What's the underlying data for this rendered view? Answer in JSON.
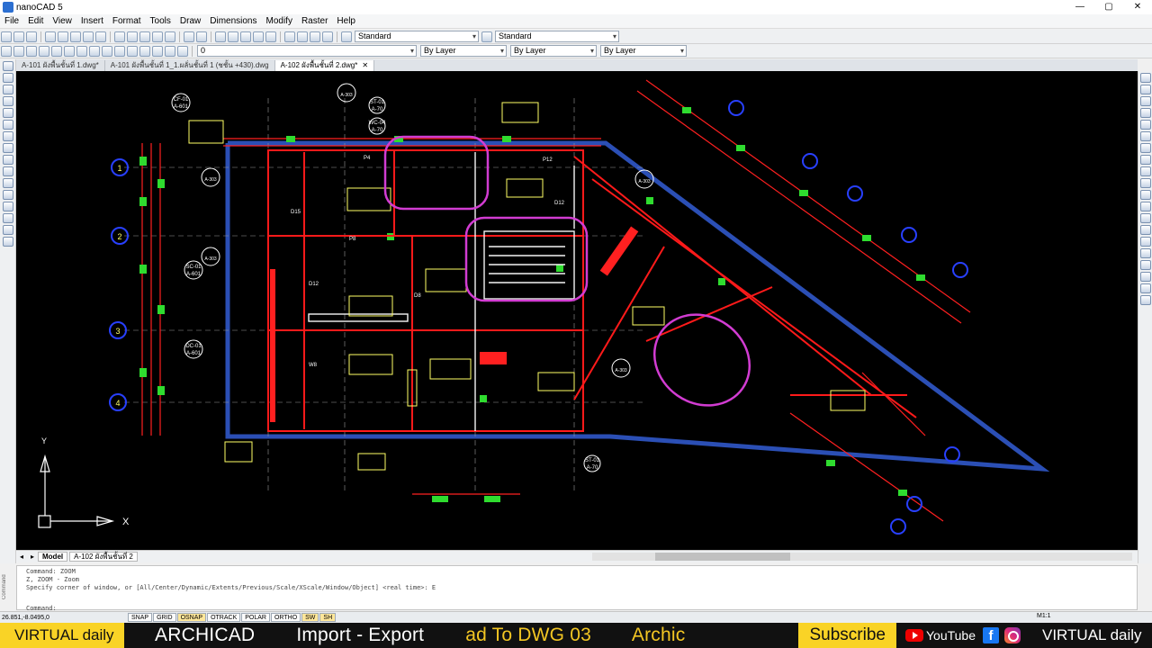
{
  "window": {
    "title": "nanoCAD 5",
    "controls": [
      "—",
      "▢",
      "✕"
    ]
  },
  "menu": [
    "File",
    "Edit",
    "View",
    "Insert",
    "Format",
    "Tools",
    "Draw",
    "Dimensions",
    "Modify",
    "Raster",
    "Help"
  ],
  "toolbar": {
    "text_style": "Standard",
    "dim_style": "Standard",
    "layer": "0",
    "color": "By Layer",
    "linetype": "By Layer",
    "lineweight": "By Layer"
  },
  "tabs": [
    {
      "label": "A-101 ผังพื้นชั้นที่ 1.dwg*",
      "active": false
    },
    {
      "label": "A-101 ผังพื้นชั้นที่ 1_1.ผลั่นชั้นที่ 1 (ชชั้น +430).dwg",
      "active": false
    },
    {
      "label": "A-102 ผังพื้นชั้นที่ 2.dwg*",
      "active": true
    }
  ],
  "drawing": {
    "grid_bubbles": [
      "1",
      "2",
      "3",
      "4"
    ],
    "section_tags": [
      {
        "code": "CF-01",
        "sheet": "A-601"
      },
      {
        "code": "SC-01",
        "sheet": "A-601"
      },
      {
        "code": "DC-01",
        "sheet": "A-601"
      },
      {
        "code": "ST-01",
        "sheet": "A-70"
      },
      {
        "code": "WC-04",
        "sheet": "A-70"
      },
      {
        "code": "ST-01",
        "sheet": "A-70"
      }
    ],
    "elevation_markers": [
      "A-303",
      "A-303",
      "A-303",
      "A-303",
      "A-303"
    ],
    "labels": [
      "D15",
      "D12",
      "D8",
      "D12",
      "W8",
      "P12",
      "P8",
      "P4"
    ],
    "ucs": {
      "y": "Y",
      "x": "X"
    }
  },
  "layout_tabs": [
    {
      "label": "Model",
      "active": true
    },
    {
      "label": "A-102 ผังพื้นชั้นที่ 2",
      "active": false
    }
  ],
  "command": {
    "side_label": "Command",
    "lines": [
      "Command: ZOOM",
      "Z, ZOOM - Zoom",
      "Specify corner of window, or [All/Center/Dynamic/Extents/Previous/Scale/XScale/Window/Object] <real time>: E",
      "Command:"
    ]
  },
  "status": {
    "coords": "26.851,-8.0495,0",
    "buttons": [
      {
        "label": "SNAP",
        "on": false
      },
      {
        "label": "GRID",
        "on": false
      },
      {
        "label": "OSNAP",
        "on": true
      },
      {
        "label": "OTRACK",
        "on": false
      },
      {
        "label": "POLAR",
        "on": false
      },
      {
        "label": "ORTHO",
        "on": false
      },
      {
        "label": "SW",
        "on": true
      },
      {
        "label": "SH",
        "on": true
      }
    ],
    "scale": "M1:1"
  },
  "banner": {
    "brand_left": "VIRTUAL daily",
    "ticker": [
      "ARCHICAD",
      "Import - Export",
      "ad To DWG 03",
      "Archic"
    ],
    "subscribe": "Subscribe",
    "youtube": "YouTube",
    "brand_right": "VIRTUAL daily"
  },
  "colors": {
    "frame_blue": "#2b4fb5",
    "wall_red": "#ff1a1a",
    "dim_green": "#2fdc2f",
    "hatch_magenta": "#d23cd2",
    "text_yellow": "#ffff66",
    "banner_yellow": "#f9d326"
  }
}
